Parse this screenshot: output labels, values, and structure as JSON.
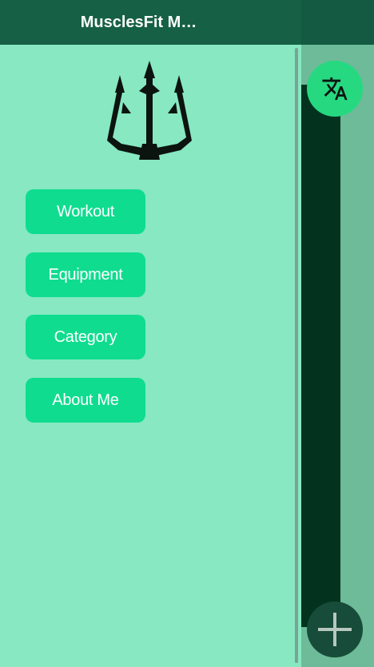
{
  "drawer": {
    "title": "MusclesFit M…",
    "logo_icon": "trident-icon",
    "menu": [
      {
        "label": "Workout"
      },
      {
        "label": "Equipment"
      },
      {
        "label": "Category"
      },
      {
        "label": "About Me"
      }
    ]
  },
  "fabs": {
    "translate_icon": "translate-icon",
    "add_icon": "plus-icon"
  },
  "colors": {
    "drawer_bg": "#87e8c2",
    "header_bg": "#166146",
    "button_bg": "#0fdc8f",
    "translate_fab_bg": "#26d981",
    "add_fab_bg": "#174b3a",
    "scrim": "#6dbb98"
  }
}
